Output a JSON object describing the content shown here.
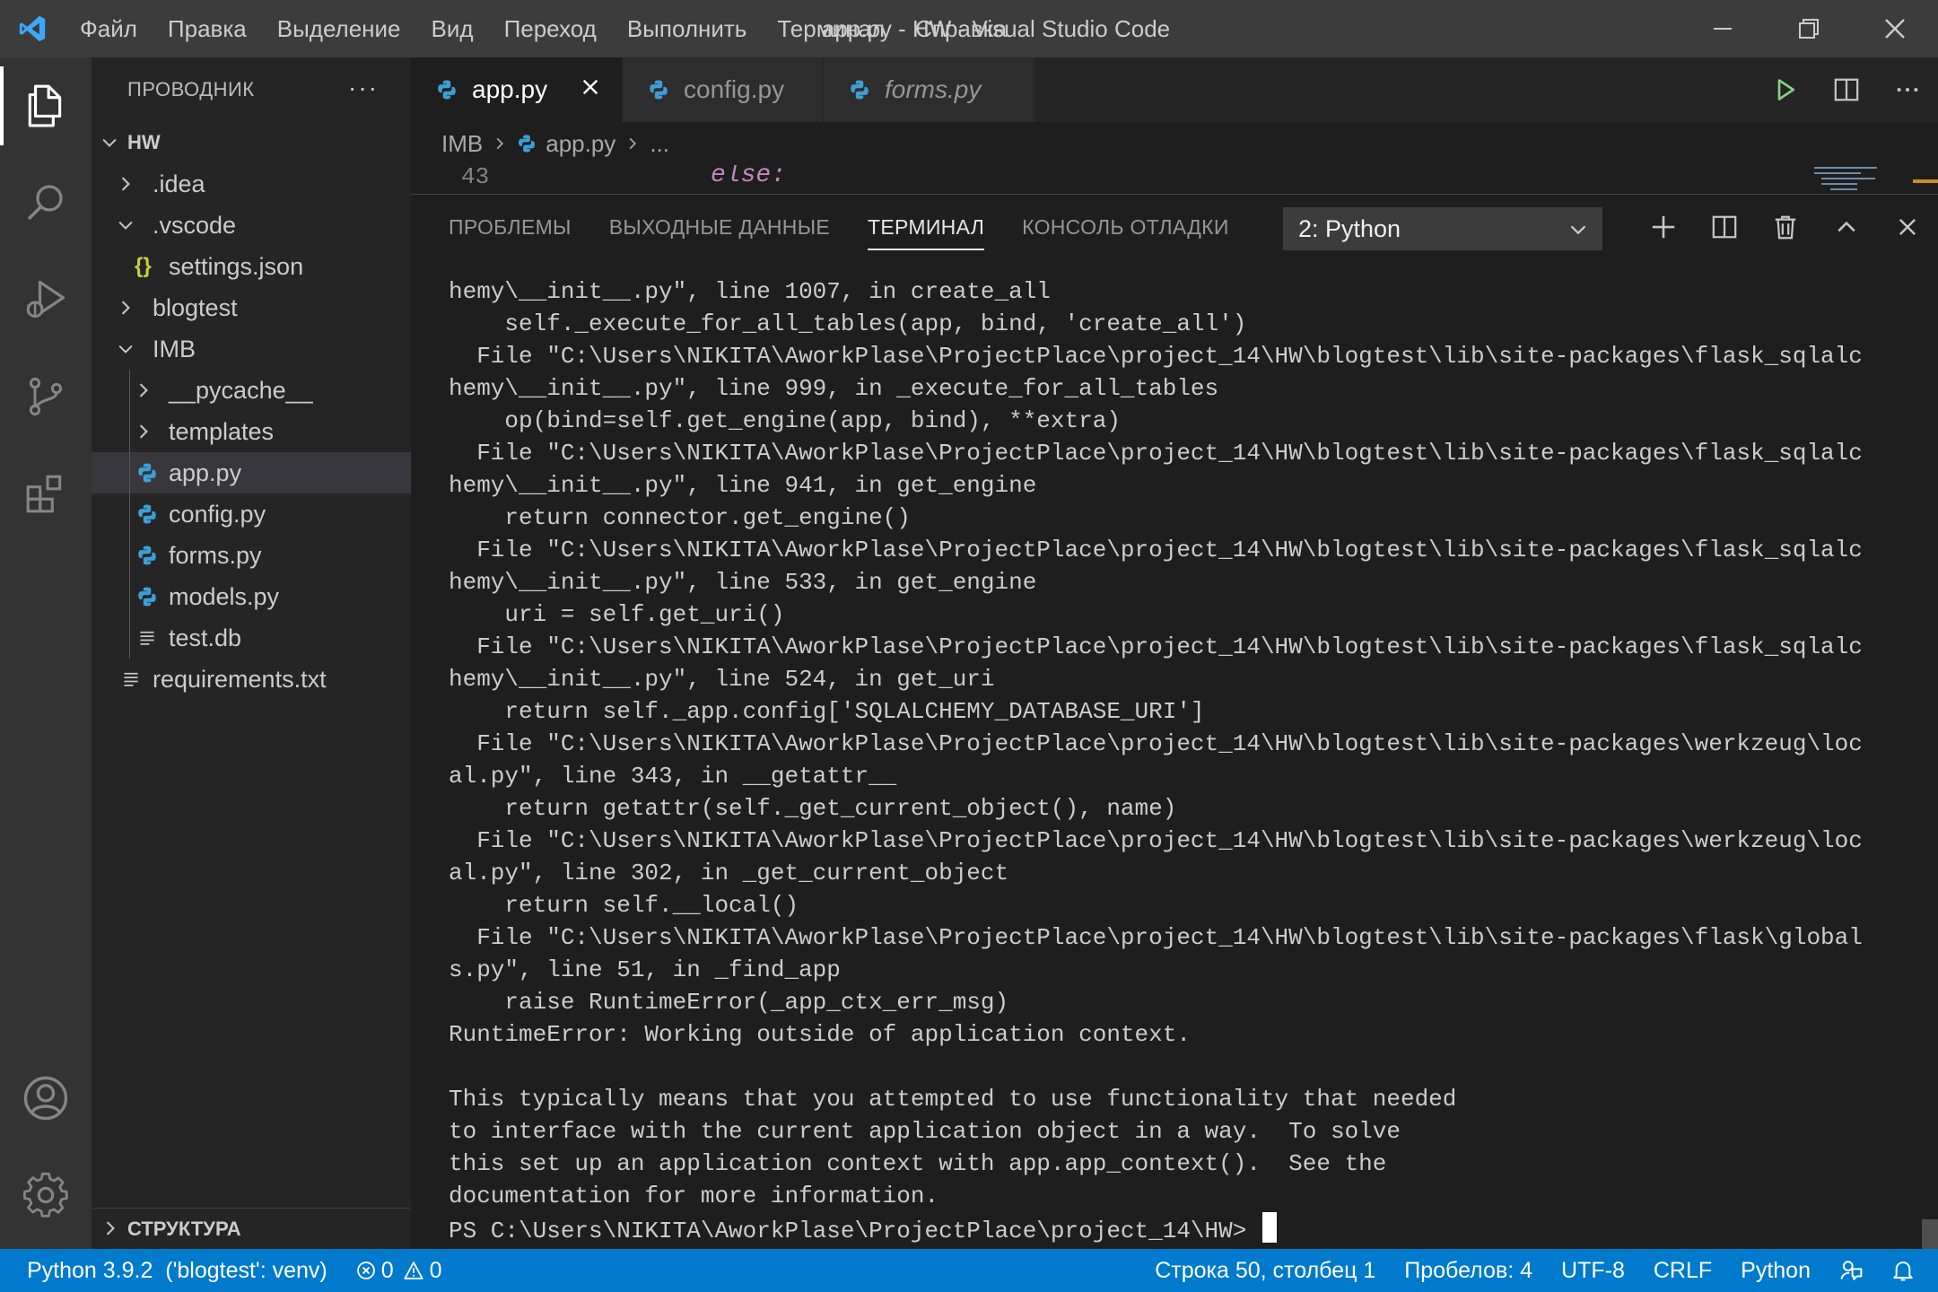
{
  "window": {
    "title": "app.py - HW - Visual Studio Code",
    "menu": [
      "Файл",
      "Правка",
      "Выделение",
      "Вид",
      "Переход",
      "Выполнить",
      "Терминал",
      "Справка"
    ]
  },
  "sidebar": {
    "header": "ПРОВОДНИК",
    "more": "···",
    "root": "HW",
    "tree": [
      {
        "label": ".idea",
        "kind": "folder",
        "expanded": false
      },
      {
        "label": ".vscode",
        "kind": "folder",
        "expanded": true
      },
      {
        "label": "settings.json",
        "kind": "json"
      },
      {
        "label": "blogtest",
        "kind": "folder",
        "expanded": false
      },
      {
        "label": "IMB",
        "kind": "folder",
        "expanded": true
      },
      {
        "label": "__pycache__",
        "kind": "folder",
        "expanded": false
      },
      {
        "label": "templates",
        "kind": "folder",
        "expanded": false
      },
      {
        "label": "app.py",
        "kind": "python",
        "selected": true
      },
      {
        "label": "config.py",
        "kind": "python"
      },
      {
        "label": "forms.py",
        "kind": "python"
      },
      {
        "label": "models.py",
        "kind": "python"
      },
      {
        "label": "test.db",
        "kind": "text"
      },
      {
        "label": "requirements.txt",
        "kind": "text"
      }
    ],
    "footer": "СТРУКТУРА"
  },
  "tabs": [
    {
      "label": "app.py",
      "active": true
    },
    {
      "label": "config.py",
      "active": false
    },
    {
      "label": "forms.py",
      "active": false,
      "italic": true
    }
  ],
  "breadcrumb": {
    "folder": "IMB",
    "file": "app.py",
    "rest": "..."
  },
  "code": {
    "line_number": "43",
    "text": "else:"
  },
  "panel": {
    "tabs": [
      "ПРОБЛЕМЫ",
      "ВЫХОДНЫЕ ДАННЫЕ",
      "ТЕРМИНАЛ",
      "КОНСОЛЬ ОТЛАДКИ"
    ],
    "active_tab": "ТЕРМИНАЛ",
    "terminal_select": "2: Python",
    "terminal_lines": [
      "hemy\\__init__.py\", line 1007, in create_all",
      "    self._execute_for_all_tables(app, bind, 'create_all')",
      "  File \"C:\\Users\\NIKITA\\AworkPlase\\ProjectPlace\\project_14\\HW\\blogtest\\lib\\site-packages\\flask_sqlalc",
      "hemy\\__init__.py\", line 999, in _execute_for_all_tables",
      "    op(bind=self.get_engine(app, bind), **extra)",
      "  File \"C:\\Users\\NIKITA\\AworkPlase\\ProjectPlace\\project_14\\HW\\blogtest\\lib\\site-packages\\flask_sqlalc",
      "hemy\\__init__.py\", line 941, in get_engine",
      "    return connector.get_engine()",
      "  File \"C:\\Users\\NIKITA\\AworkPlase\\ProjectPlace\\project_14\\HW\\blogtest\\lib\\site-packages\\flask_sqlalc",
      "hemy\\__init__.py\", line 533, in get_engine",
      "    uri = self.get_uri()",
      "  File \"C:\\Users\\NIKITA\\AworkPlase\\ProjectPlace\\project_14\\HW\\blogtest\\lib\\site-packages\\flask_sqlalc",
      "hemy\\__init__.py\", line 524, in get_uri",
      "    return self._app.config['SQLALCHEMY_DATABASE_URI']",
      "  File \"C:\\Users\\NIKITA\\AworkPlase\\ProjectPlace\\project_14\\HW\\blogtest\\lib\\site-packages\\werkzeug\\loc",
      "al.py\", line 343, in __getattr__",
      "    return getattr(self._get_current_object(), name)",
      "  File \"C:\\Users\\NIKITA\\AworkPlase\\ProjectPlace\\project_14\\HW\\blogtest\\lib\\site-packages\\werkzeug\\loc",
      "al.py\", line 302, in _get_current_object",
      "    return self.__local()",
      "  File \"C:\\Users\\NIKITA\\AworkPlase\\ProjectPlace\\project_14\\HW\\blogtest\\lib\\site-packages\\flask\\global",
      "s.py\", line 51, in _find_app",
      "    raise RuntimeError(_app_ctx_err_msg)",
      "RuntimeError: Working outside of application context.",
      "",
      "This typically means that you attempted to use functionality that needed",
      "to interface with the current application object in a way.  To solve",
      "this set up an application context with app.app_context().  See the",
      "documentation for more information."
    ],
    "prompt": "PS C:\\Users\\NIKITA\\AworkPlase\\ProjectPlace\\project_14\\HW> "
  },
  "statusbar": {
    "interpreter": "Python 3.9.2  ('blogtest': venv)",
    "errors": "0",
    "warnings": "0",
    "position": "Строка 50, столбец 1",
    "spaces": "Пробелов: 4",
    "encoding": "UTF-8",
    "eol": "CRLF",
    "language": "Python"
  },
  "colors": {
    "accent": "#007acc",
    "python_icon": "#3c9fd6",
    "json_icon": "#cbcb41",
    "keyword": "#c586c0",
    "run": "#89d185"
  }
}
